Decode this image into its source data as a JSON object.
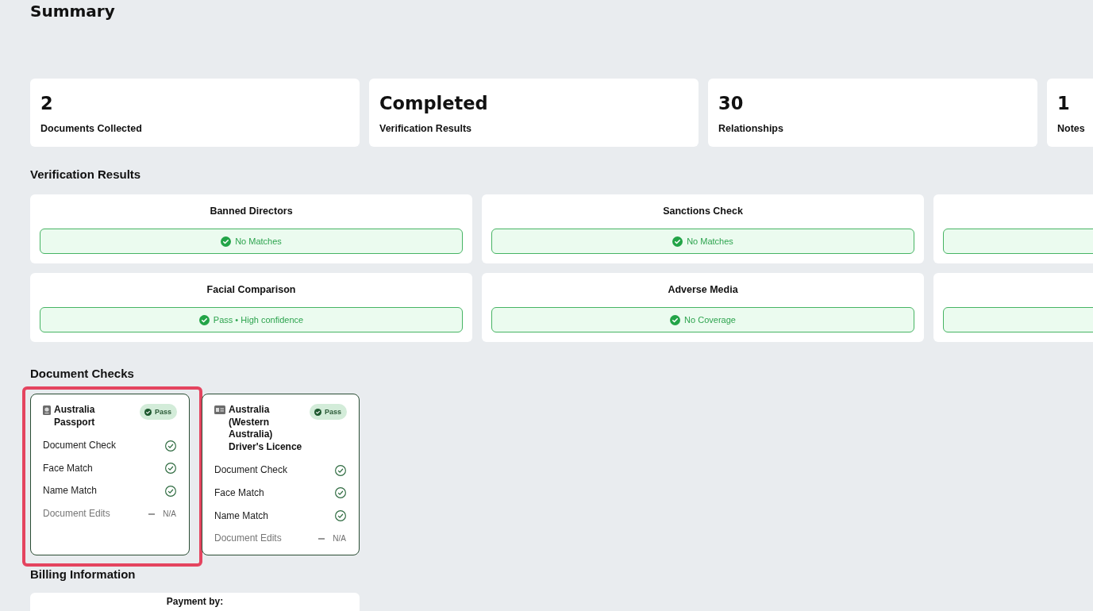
{
  "page_title": "Summary",
  "summary_cards": [
    {
      "value": "2",
      "label": "Documents Collected"
    },
    {
      "value": "Completed",
      "label": "Verification Results"
    },
    {
      "value": "30",
      "label": "Relationships"
    },
    {
      "value": "1",
      "label": "Notes"
    }
  ],
  "verification_results": {
    "heading": "Verification Results",
    "items": [
      {
        "title": "Banned Directors",
        "result": "No Matches",
        "passed": true
      },
      {
        "title": "Sanctions Check",
        "result": "No Matches",
        "passed": true
      },
      {
        "passed": true
      },
      {
        "title": "Facial Comparison",
        "result": "Pass • High confidence",
        "passed": true
      },
      {
        "title": "Adverse Media",
        "result": "No Coverage",
        "passed": true
      },
      {
        "passed": true
      }
    ]
  },
  "document_checks": {
    "heading": "Document Checks",
    "documents": [
      {
        "kind": "passport",
        "title": "Australia Passport",
        "badge": "Pass",
        "passed": true,
        "highlighted": true,
        "checks": [
          {
            "kind": "check",
            "label": "Document Check",
            "passed": true
          },
          {
            "kind": "check",
            "label": "Face Match",
            "passed": true
          },
          {
            "kind": "check",
            "label": "Name Match",
            "passed": true
          },
          {
            "kind": "info",
            "label": "Document Edits",
            "value": "N/A"
          }
        ]
      },
      {
        "kind": "licence",
        "title": "Australia (Western Australia) Driver's Licence",
        "badge": "Pass",
        "passed": true,
        "highlighted": false,
        "checks": [
          {
            "kind": "check",
            "label": "Document Check",
            "passed": true
          },
          {
            "kind": "check",
            "label": "Face Match",
            "passed": true
          },
          {
            "kind": "check",
            "label": "Name Match",
            "passed": true
          },
          {
            "kind": "info",
            "label": "Document Edits",
            "value": "N/A"
          }
        ]
      }
    ]
  },
  "billing": {
    "heading": "Billing Information",
    "card_title": "Payment by:"
  }
}
